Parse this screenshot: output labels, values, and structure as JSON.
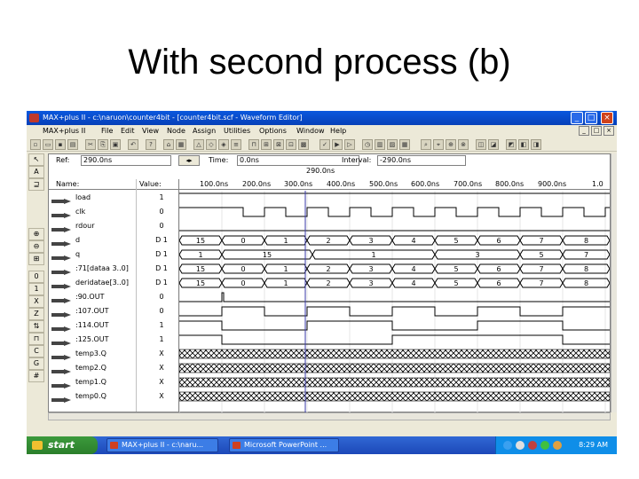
{
  "slide": {
    "title": "With second process (b)"
  },
  "window": {
    "title": "MAX+plus II - c:\\naruon\\counter4bit - [counter4bit.scf - Waveform Editor]",
    "buttons": [
      "_",
      "□",
      "×"
    ]
  },
  "menu": {
    "items": [
      "MAX+plus II",
      "File",
      "Edit",
      "View",
      "Node",
      "Assign",
      "Utilities",
      "Options",
      "Window",
      "Help"
    ]
  },
  "controls": {
    "ref_label": "Ref:",
    "ref_value": "290.0ns",
    "time_label": "Time:",
    "time_value": "0.0ns",
    "interval_label": "Interval:",
    "interval_value": "-290.0ns",
    "cursor_time": "290.0ns"
  },
  "columns": {
    "name": "Name:",
    "value": "Value:"
  },
  "time_ticks": [
    "100.0ns",
    "200.0ns",
    "300.0ns",
    "400.0ns",
    "500.0ns",
    "600.0ns",
    "700.0ns",
    "800.0ns",
    "900.0ns",
    "1.0"
  ],
  "signals": [
    {
      "name": "load",
      "value": "1",
      "icon": "input-pin-icon"
    },
    {
      "name": "clk",
      "value": "0",
      "icon": "input-pin-icon"
    },
    {
      "name": "rdour",
      "value": "0",
      "icon": "input-pin-icon"
    },
    {
      "name": "d",
      "value": "D 1",
      "icon": "bus-input-icon"
    },
    {
      "name": "q",
      "value": "D 1",
      "icon": "bus-output-icon"
    },
    {
      "name": ":71[dataa 3..0]",
      "value": "D 1",
      "icon": "bus-buried-icon"
    },
    {
      "name": "deridatae[3..0]",
      "value": "D 1",
      "icon": "bus-buried-icon"
    },
    {
      "name": ":90.OUT",
      "value": "0",
      "icon": "buried-node-icon"
    },
    {
      "name": ":107.OUT",
      "value": "0",
      "icon": "buried-node-icon"
    },
    {
      "name": ":114.OUT",
      "value": "1",
      "icon": "buried-node-icon"
    },
    {
      "name": ":125.OUT",
      "value": "1",
      "icon": "buried-node-icon"
    },
    {
      "name": "temp3.Q",
      "value": "X",
      "icon": "buried-node-icon"
    },
    {
      "name": "temp2.Q",
      "value": "X",
      "icon": "buried-node-icon"
    },
    {
      "name": "temp1.Q",
      "value": "X",
      "icon": "buried-node-icon"
    },
    {
      "name": "temp0.Q",
      "value": "X",
      "icon": "buried-node-icon"
    }
  ],
  "waves": {
    "d_values": [
      "15",
      "0",
      "1",
      "2",
      "3",
      "4",
      "5",
      "6",
      "7",
      "8"
    ],
    "q_values": [
      "1",
      "15",
      "1",
      "3",
      "5",
      "7"
    ],
    "dataa_values": [
      "15",
      "0",
      "1",
      "2",
      "3",
      "4",
      "5",
      "6",
      "7",
      "8"
    ],
    "deridatae_values": [
      "15",
      "0",
      "1",
      "2",
      "3",
      "4",
      "5",
      "6",
      "7",
      "8"
    ]
  },
  "taskbar": {
    "start": "start",
    "tasks": [
      "MAX+plus II - c:\\naru...",
      "Microsoft PowerPoint ..."
    ],
    "clock": "8:29 AM"
  },
  "colors": {
    "titlebar": "#0a58de",
    "taskbar": "#3168d5",
    "start": "#3c9a3c",
    "cursor": "#3a3aa8"
  }
}
